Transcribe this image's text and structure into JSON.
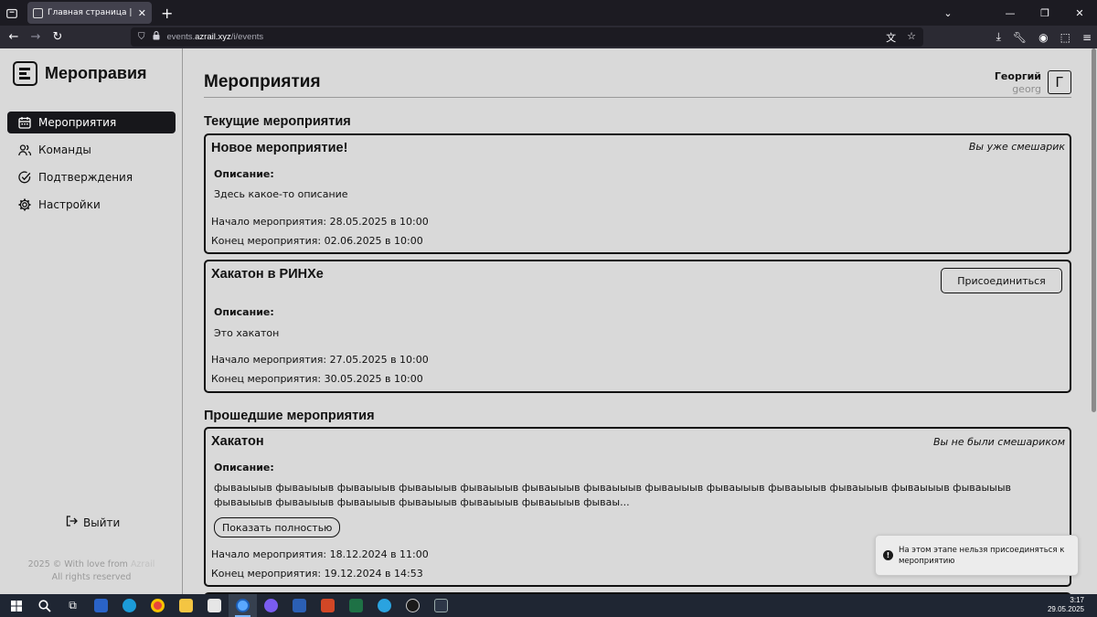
{
  "browser": {
    "tab_title": "Главная страница | Мероприя",
    "url_prefix": "events.",
    "url_domain": "azrail.xyz",
    "url_path": "/i/events"
  },
  "sidebar": {
    "brand": "Мероправия",
    "items": [
      {
        "label": "Мероприятия",
        "icon": "calendar-icon",
        "active": true
      },
      {
        "label": "Команды",
        "icon": "users-icon",
        "active": false
      },
      {
        "label": "Подтверждения",
        "icon": "check-circle-icon",
        "active": false
      },
      {
        "label": "Настройки",
        "icon": "gear-icon",
        "active": false
      }
    ],
    "logout": "Выйти",
    "footer_line1_prefix": "2025 © With love from ",
    "footer_line1_author": "Azrail",
    "footer_line2": "All rights reserved"
  },
  "header": {
    "title": "Мероприятия",
    "user_name": "Георгий",
    "user_login": "georg",
    "avatar_letter": "Г"
  },
  "sections": {
    "current": "Текущие мероприятия",
    "past": "Прошедшие мероприятия"
  },
  "events": {
    "e1": {
      "title": "Новое мероприятие!",
      "status": "Вы уже смешарик",
      "desc_label": "Описание:",
      "desc": "Здесь какое-то описание",
      "start": "Начало мероприятия: 28.05.2025 в 10:00",
      "end": "Конец мероприятия: 02.06.2025 в 10:00"
    },
    "e2": {
      "title": "Хакатон в РИНХе",
      "join_label": "Присоединиться",
      "desc_label": "Описание:",
      "desc": "Это хакатон",
      "start": "Начало мероприятия: 27.05.2025 в 10:00",
      "end": "Конец мероприятия: 30.05.2025 в 10:00"
    },
    "e3": {
      "title": "Хакатон",
      "status": "Вы не были смешариком",
      "desc_label": "Описание:",
      "desc": "фываыыыв фываыыыв фываыыыв фываыыыв фываыыыв фываыыыв фываыыыв фываыыыв фываыыыв фываыыыв фываыыыв фываыыыв фываыыыв фываыыыв фываыыыв фываыыыв фываыыыв фываыыыв фываыыыв фываы...",
      "show_full": "Показать полностью",
      "start": "Начало мероприятия: 18.12.2024 в 11:00",
      "end": "Конец мероприятия: 19.12.2024 в 14:53"
    }
  },
  "toast": {
    "text": "На этом этапе нельзя присоединяться к мероприятию"
  },
  "taskbar": {
    "time": "3:17",
    "date": "29.05.2025"
  }
}
